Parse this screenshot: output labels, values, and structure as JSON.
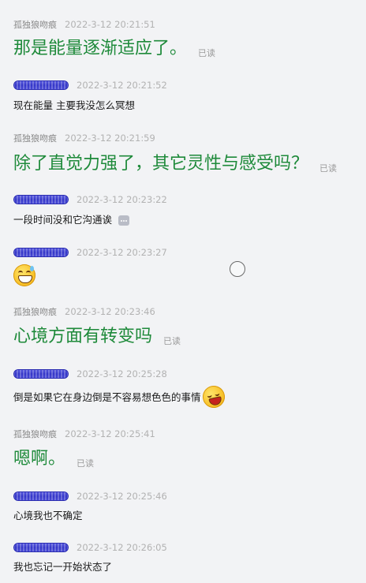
{
  "messages": [
    {
      "sender": "孤独狼吻痕",
      "time": "2022-3-12 20:21:51",
      "text": "那是能量逐渐适应了。",
      "read": "已读"
    },
    {
      "sender": "",
      "time": "2022-3-12 20:21:52",
      "text": "现在能量 主要我没怎么冥想"
    },
    {
      "sender": "孤独狼吻痕",
      "time": "2022-3-12 20:21:59",
      "text": "除了直觉力强了，其它灵性与感受吗？",
      "read": "已读"
    },
    {
      "sender": "",
      "time": "2022-3-12 20:23:22",
      "text": "一段时间没和它沟通诶"
    },
    {
      "sender": "",
      "time": "2022-3-12 20:23:27",
      "emoji": "grinning-sweat-emoji"
    },
    {
      "sender": "孤独狼吻痕",
      "time": "2022-3-12 20:23:46",
      "text": "心境方面有转变吗",
      "read": "已读"
    },
    {
      "sender": "",
      "time": "2022-3-12 20:25:28",
      "text": "倒是如果它在身边倒是不容易想色色的事情"
    },
    {
      "sender": "孤独狼吻痕",
      "time": "2022-3-12 20:25:41",
      "text": "嗯啊。",
      "read": "已读"
    },
    {
      "sender": "",
      "time": "2022-3-12 20:25:46",
      "text": "心境我也不确定"
    },
    {
      "sender": "",
      "time": "2022-3-12 20:26:05",
      "text": "我也忘记一开始状态了"
    }
  ],
  "colors": {
    "background": "#f2f3f5",
    "sent_text": "#1e8a3a",
    "received_text": "#1a1a1a",
    "timestamp": "#b2b2b2",
    "redaction": "#3e40d0"
  }
}
